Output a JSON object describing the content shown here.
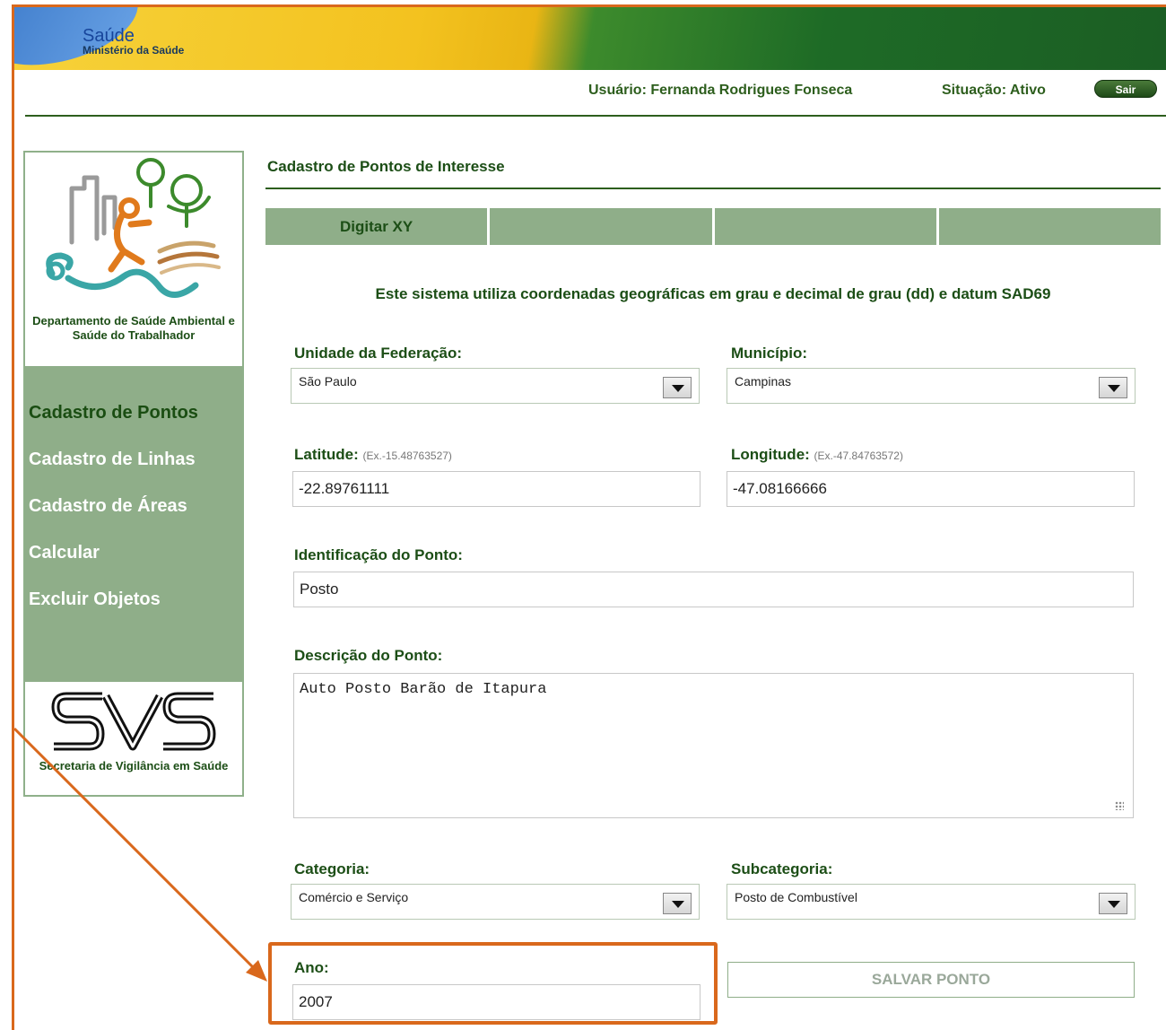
{
  "header": {
    "brand_title": "Saúde",
    "brand_subtitle": "Ministério da Saúde",
    "user": "Usuário: Fernanda Rodrigues Fonseca",
    "status": "Situação: Ativo",
    "logout_label": "Sair"
  },
  "sidebar": {
    "department": "Departamento de Saúde Ambiental e Saúde do Trabalhador",
    "items": [
      {
        "label": "Cadastro de Pontos",
        "active": true
      },
      {
        "label": "Cadastro de Linhas",
        "active": false
      },
      {
        "label": "Cadastro de Áreas",
        "active": false
      },
      {
        "label": "Calcular",
        "active": false
      },
      {
        "label": "Excluir Objetos",
        "active": false
      }
    ],
    "svs_label": "Secretaria de Vigilância em Saúde"
  },
  "main": {
    "title": "Cadastro de Pontos de Interesse",
    "tabs": [
      {
        "label": "Digitar XY"
      },
      {
        "label": ""
      },
      {
        "label": ""
      },
      {
        "label": ""
      }
    ],
    "info": "Este sistema utiliza coordenadas geográficas em grau e decimal de grau (dd) e datum SAD69",
    "uf_label": "Unidade da Federação:",
    "uf_value": "São Paulo",
    "municipio_label": "Município:",
    "municipio_value": "Campinas",
    "latitude_label": "Latitude:",
    "latitude_hint": "(Ex.-15.48763527)",
    "latitude_value": "-22.89761111",
    "longitude_label": "Longitude:",
    "longitude_hint": "(Ex.-47.84763572)",
    "longitude_value": "-47.08166666",
    "identificacao_label": "Identificação do Ponto:",
    "identificacao_value": "Posto",
    "descricao_label": "Descrição do Ponto:",
    "descricao_value": "Auto Posto Barão de Itapura",
    "categoria_label": "Categoria:",
    "categoria_value": "Comércio e Serviço",
    "subcategoria_label": "Subcategoria:",
    "subcategoria_value": "Posto de Combustível",
    "ano_label": "Ano:",
    "ano_value": "2007",
    "save_label": "SALVAR PONTO"
  },
  "colors": {
    "accent_orange": "#d9681c",
    "sidebar_green": "#8fae89",
    "text_green": "#1c4e16"
  }
}
